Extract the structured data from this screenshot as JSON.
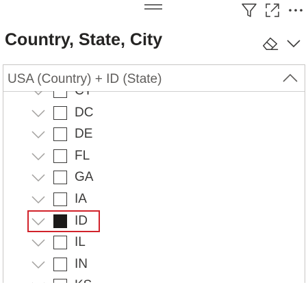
{
  "header": {
    "icons": [
      "drag-handle-icon",
      "filter-icon",
      "focus-mode-icon",
      "more-options-icon"
    ]
  },
  "slicer": {
    "title": "Country, State, City",
    "selection_summary": "USA (Country) + ID (State)",
    "dropdown_expanded": true,
    "items": [
      {
        "label": "CT",
        "checked": false,
        "partial": true
      },
      {
        "label": "DC",
        "checked": false
      },
      {
        "label": "DE",
        "checked": false
      },
      {
        "label": "FL",
        "checked": false
      },
      {
        "label": "GA",
        "checked": false
      },
      {
        "label": "IA",
        "checked": false
      },
      {
        "label": "ID",
        "checked": true,
        "highlighted": true
      },
      {
        "label": "IL",
        "checked": false
      },
      {
        "label": "IN",
        "checked": false
      },
      {
        "label": "KS",
        "checked": false,
        "partial": true
      }
    ]
  },
  "colors": {
    "highlight": "#d1222a",
    "text": "#252423",
    "border": "#c8c6c4"
  }
}
